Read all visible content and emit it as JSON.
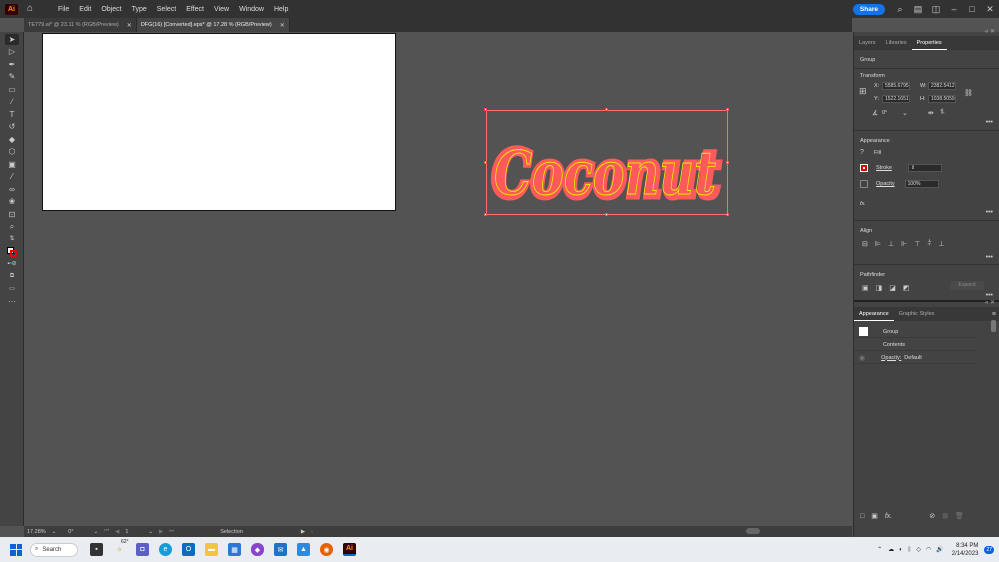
{
  "app": {
    "logo": "Ai",
    "menu": [
      "File",
      "Edit",
      "Object",
      "Type",
      "Select",
      "Effect",
      "View",
      "Window",
      "Help"
    ],
    "share_label": "Share"
  },
  "tabs": [
    {
      "label": "TE779.ai* @ 23.11 % (RGB/Preview)",
      "active": false
    },
    {
      "label": "DFG(16) [Converted].eps* @ 17.28 % (RGB/Preview)",
      "active": true
    }
  ],
  "tools": [
    "selection-tool",
    "direct-selection-tool",
    "pen-tool",
    "pencil-tool",
    "rectangle-tool",
    "paintbrush-tool",
    "type-tool",
    "rotate-tool",
    "eraser-tool",
    "shape-builder-tool",
    "gradient-tool",
    "eyedropper-tool",
    "blend-tool",
    "symbol-sprayer-tool",
    "artboard-tool",
    "zoom-tool"
  ],
  "canvas": {
    "artwork_text": "Coconut",
    "artwork_fill": "#ff5a5a",
    "artwork_accent": "#e8f000"
  },
  "status": {
    "zoom": "17.28%",
    "rotation": "0°",
    "artboard": "1",
    "tool": "Selection"
  },
  "properties": {
    "tabs": [
      "Layers",
      "Libraries",
      "Properties"
    ],
    "selection_type": "Group",
    "transform": {
      "title": "Transform",
      "x_label": "X:",
      "x": "5585.6795",
      "y_label": "Y:",
      "y": "1522.1651",
      "w_label": "W:",
      "w": "2382.5412",
      "h_label": "H:",
      "h": "1038.5059",
      "angle": "0°"
    },
    "appearance": {
      "title": "Appearance",
      "fill_label": "Fill",
      "stroke_label": "Stroke",
      "opacity_label": "Opacity",
      "opacity": "100%",
      "fx": "fx."
    },
    "align": {
      "title": "Align"
    },
    "pathfinder": {
      "title": "Pathfinder",
      "expand_label": "Expand"
    }
  },
  "appearance_panel": {
    "tabs": [
      "Appearance",
      "Graphic Styles"
    ],
    "rows": [
      {
        "label": "Group"
      },
      {
        "label": "Contents"
      },
      {
        "label": "Opacity:",
        "value": "Default"
      }
    ]
  },
  "taskbar": {
    "search_label": "Search",
    "weather": "62°",
    "time": "8:34 PM",
    "date": "2/14/2023",
    "notifications": "27"
  }
}
